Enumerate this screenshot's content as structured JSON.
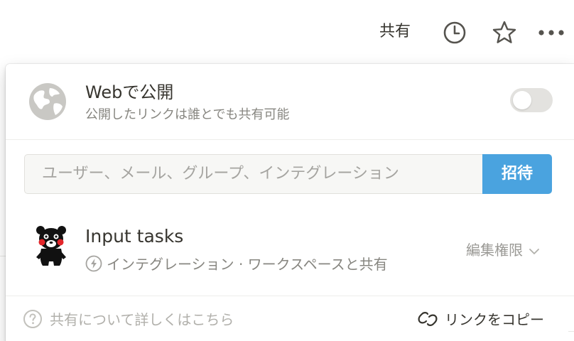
{
  "topbar": {
    "share_label": "共有",
    "clock_icon": "clock-icon",
    "star_icon": "star-icon",
    "more_icon": "more-icon"
  },
  "web_publish": {
    "title": "Webで公開",
    "description": "公開したリンクは誰とでも共有可能",
    "enabled": false
  },
  "invite": {
    "placeholder": "ユーザー、メール、グループ、インテグレーション",
    "button_label": "招待"
  },
  "members": [
    {
      "name": "Input tasks",
      "subtitle": "インテグレーション · ワークスペースと共有",
      "permission": "編集権限"
    }
  ],
  "footer": {
    "learn_more": "共有について詳しくはこちら",
    "copy_link": "リンクをコピー"
  },
  "colors": {
    "accent": "#4aa3df",
    "text": "#37352f",
    "muted": "#878680"
  }
}
